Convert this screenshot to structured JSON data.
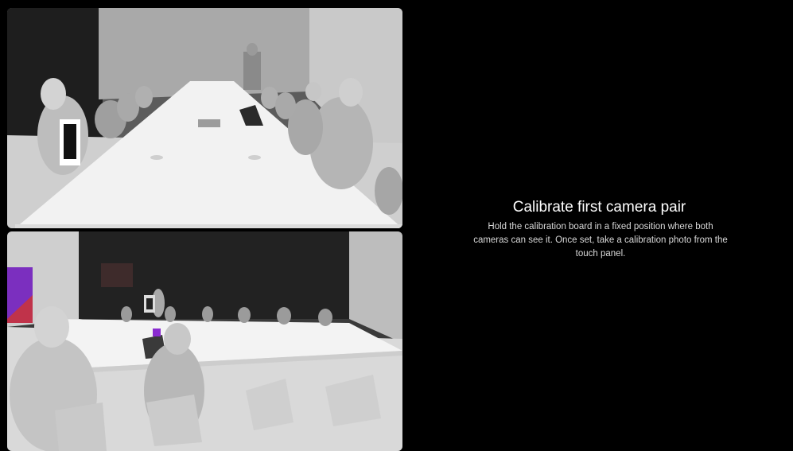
{
  "feeds": [
    {
      "name": "camera-1-feed"
    },
    {
      "name": "camera-2-feed"
    }
  ],
  "instructions": {
    "title": "Calibrate first camera pair",
    "description": "Hold the calibration board in a fixed position where both cameras can see it. Once set, take a calibration photo from the touch panel."
  },
  "colors": {
    "background": "#000000",
    "title": "#ffffff",
    "description": "#d8d8d8"
  }
}
